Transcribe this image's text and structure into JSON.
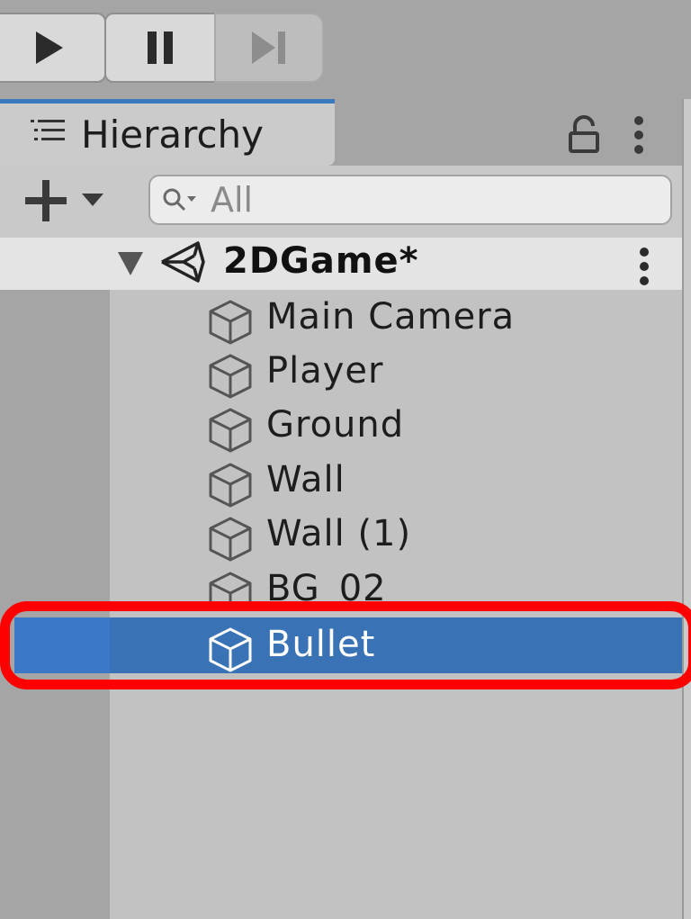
{
  "toolbar": {
    "play_icon": "play-icon",
    "pause_icon": "pause-icon",
    "step_icon": "step-icon"
  },
  "hierarchy": {
    "tab_title": "Hierarchy",
    "search": {
      "placeholder": "All",
      "value": ""
    },
    "scene": {
      "name": "2DGame*"
    },
    "items": [
      {
        "label": "Main Camera"
      },
      {
        "label": "Player"
      },
      {
        "label": "Ground"
      },
      {
        "label": "Wall"
      },
      {
        "label": "Wall (1)"
      },
      {
        "label": "BG_02"
      },
      {
        "label": "Bullet",
        "selected": true
      }
    ]
  },
  "colors": {
    "accent": "#3a79bd",
    "selection": "#3a72b6",
    "highlight": "#ff0000"
  }
}
